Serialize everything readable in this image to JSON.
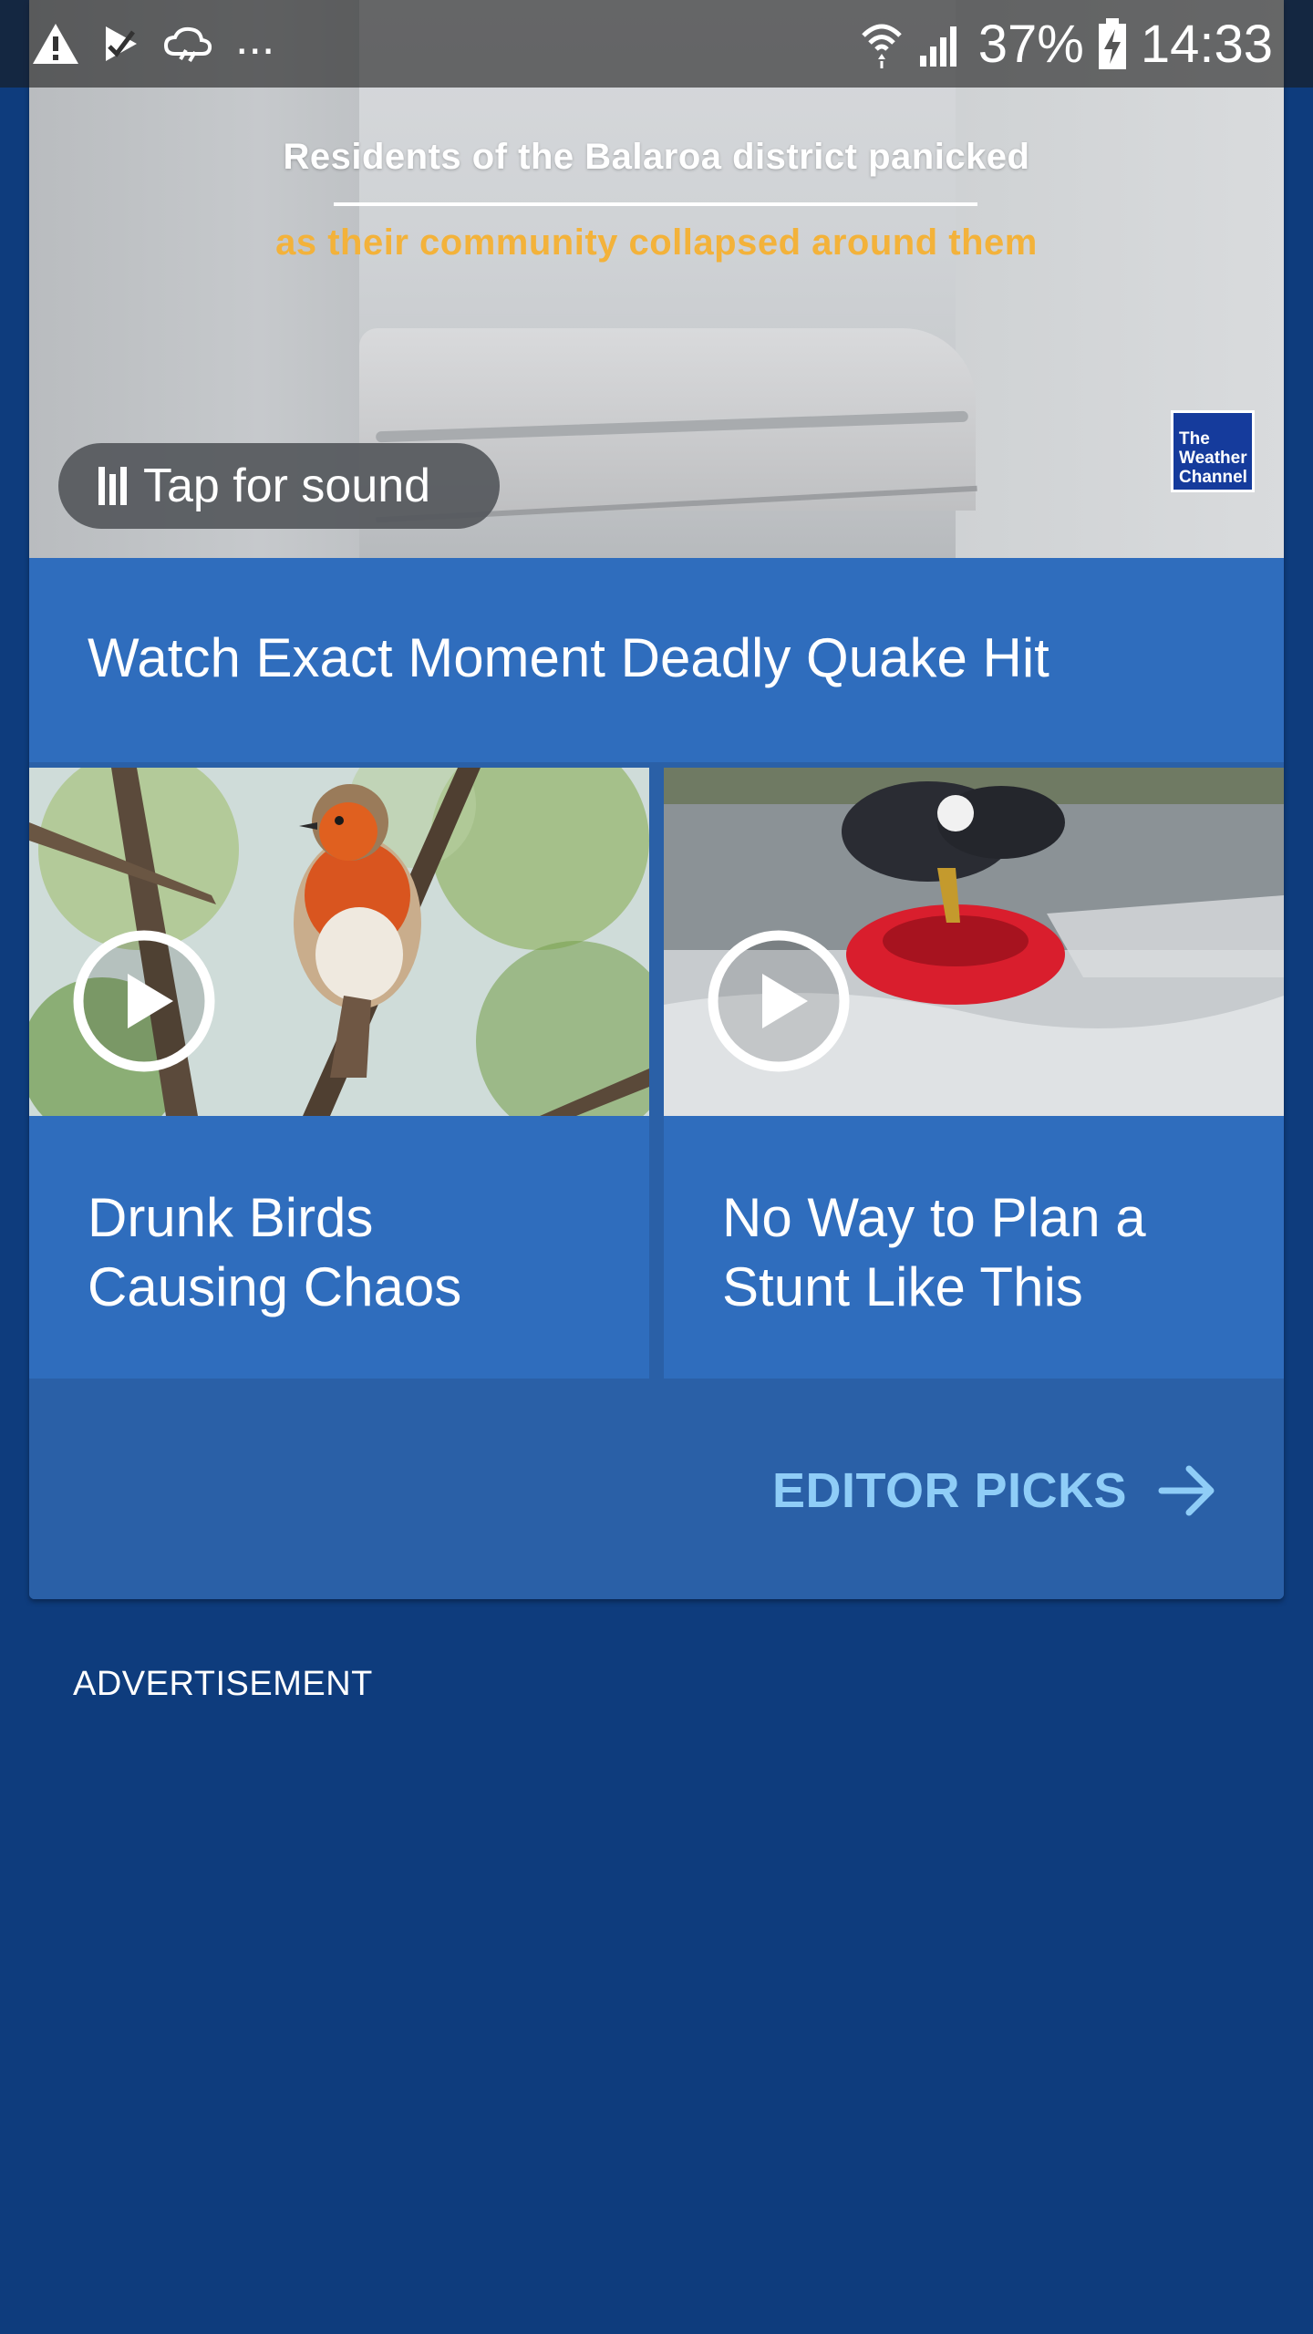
{
  "status_bar": {
    "overflow_dots": "...",
    "battery_percent": "37%",
    "time": "14:33"
  },
  "hero": {
    "caption_line1": "Residents of the Balaroa district panicked",
    "caption_line2": "as their community collapsed around them",
    "logo_text": [
      "The",
      "Weather",
      "Channel"
    ],
    "sound_label": "Tap for sound",
    "title": "Watch Exact Moment Deadly Quake Hit"
  },
  "tiles": [
    {
      "title_line1": "Drunk Birds",
      "title_line2": "Causing Chaos",
      "thumbnail": "robin-bird-on-branch"
    },
    {
      "title_line1": "No Way to Plan a",
      "title_line2": "Stunt Like This",
      "thumbnail": "eagle-on-red-tube-in-water"
    }
  ],
  "editor_picks": {
    "label": "EDITOR PICKS",
    "icon": "arrow-right-icon"
  },
  "advertisement_label": "ADVERTISEMENT",
  "colors": {
    "page_background": "#0e3c7d",
    "card_background": "#2a60a7",
    "tile_background": "#2f6dbd",
    "link_color": "#8fcdf7",
    "caption_highlight": "#f3b23a"
  }
}
